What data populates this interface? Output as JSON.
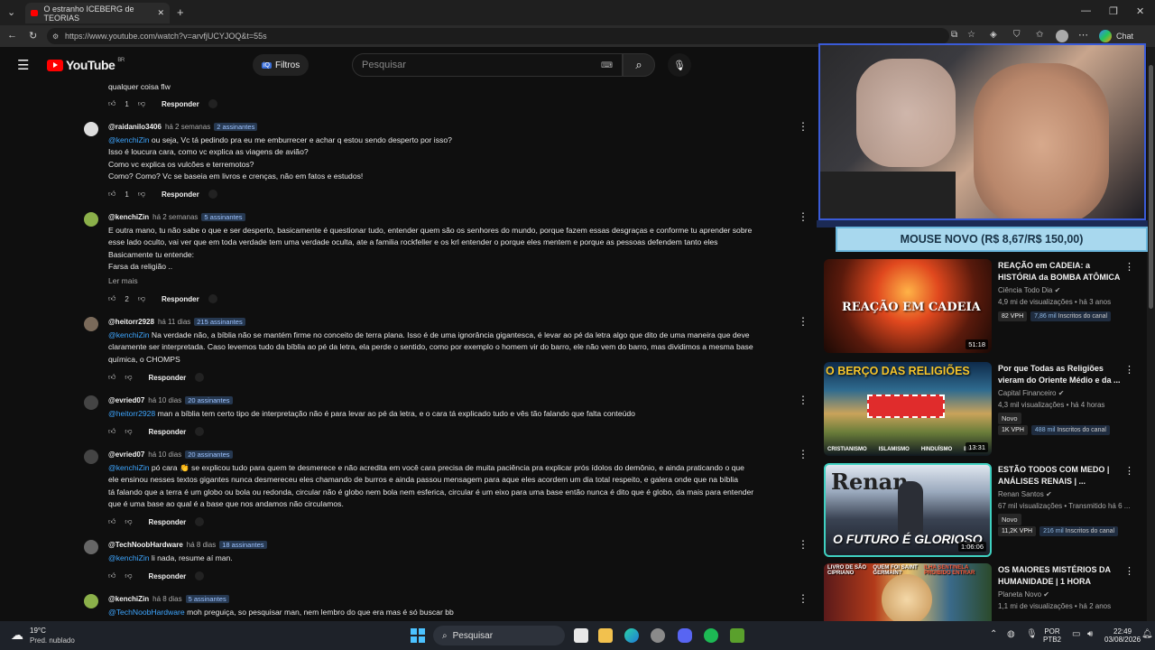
{
  "browser": {
    "tab_title": "O estranho ICEBERG de TEORIAS",
    "url": "https://www.youtube.com/watch?v=arvfjUCYJOQ&t=55s",
    "copilot_label": "Chat"
  },
  "header": {
    "logo_text": "YouTube",
    "logo_region": "BR",
    "filters_label": "Filtros",
    "search_placeholder": "Pesquisar"
  },
  "comments": [
    {
      "text": "qualquer coisa flw",
      "likes": "1",
      "reply": "Responder"
    },
    {
      "handle": "@raidanilo3406",
      "time": "há 2 semanas",
      "badge": "2 assinantes",
      "lines": [
        {
          "mention": "@kenchiZin",
          "text": " ou seja, Vc tá pedindo pra eu me emburrecer e achar q estou sendo desperto por isso?"
        },
        {
          "text": "Isso é loucura cara, como vc explica as viagens de avião?"
        },
        {
          "text": "Como vc explica os vulcões e terremotos?"
        },
        {
          "text": "Como? Como? Vc se baseia em livros e crenças, não em fatos e estudos!"
        }
      ],
      "likes": "1",
      "reply": "Responder"
    },
    {
      "handle": "@kenchiZin",
      "time": "há 2 semanas",
      "badge": "5 assinantes",
      "lines": [
        {
          "text": "E outra mano, tu não sabe o que e ser desperto, basicamente é questionar tudo, entender quem são os senhores do mundo, porque fazem essas desgraças e conforme tu aprender sobre"
        },
        {
          "text": "esse lado oculto, vai ver que em toda verdade tem uma verdade oculta, ate a familia rockfeller e os krl entender o porque eles mentem e porque as pessoas defendem tanto eles"
        },
        {
          "text": "Basicamente tu entende:"
        },
        {
          "text": "Farsa da religião .."
        }
      ],
      "read_more": "Ler mais",
      "likes": "2",
      "reply": "Responder"
    },
    {
      "handle": "@heitorr2928",
      "time": "há 11 dias",
      "badge": "215 assinantes",
      "lines": [
        {
          "mention": "@kenchiZin",
          "text": " Na verdade não, a bíblia não se mantém firme no conceito de terra plana. Isso é de uma ignorância gigantesca, é levar ao pé da letra algo que dito de uma maneira que deve"
        },
        {
          "text": "claramente ser interpretada. Caso levemos tudo da bíblia ao pé da letra, ela perde o sentido, como por exemplo o homem vir do barro, ele não vem do barro, mas dividimos a mesma base"
        },
        {
          "text": "química, o CHOMPS"
        }
      ],
      "reply": "Responder"
    },
    {
      "handle": "@evried07",
      "time": "há 10 dias",
      "badge": "20 assinantes",
      "lines": [
        {
          "mention": "@heitorr2928",
          "text": " man a bíblia tem certo tipo de interpretação não é para levar ao pé da letra, e o cara tá explicado tudo e vês tão falando que falta conteúdo"
        }
      ],
      "reply": "Responder"
    },
    {
      "handle": "@evried07",
      "time": "há 10 dias",
      "badge": "20 assinantes",
      "lines": [
        {
          "mention": "@kenchiZin",
          "text": " pó cara 👏 se explicou tudo para quem te desmerece e não acredita em você cara precisa de muita paciência pra explicar prós ídolos do demônio, e ainda praticando o que"
        },
        {
          "text": "ele ensinou nesses textos gigantes nunca desmereceu eles chamando de burros e ainda passou mensagem para aque eles acordem um dia total respeito, e galera onde que na bíblia"
        },
        {
          "text": "tá falando que a terra é um globo ou bola ou redonda, circular não é globo nem bola nem esferica, circular é um eixo para uma base então nunca é dito que é globo, da mais para entender"
        },
        {
          "text": "que é uma base ao qual é a base que nos andamos não circulamos."
        }
      ],
      "reply": "Responder"
    },
    {
      "handle": "@TechNoobHardware",
      "time": "há 8 dias",
      "badge": "18 assinantes",
      "lines": [
        {
          "mention": "@kenchiZin",
          "text": " li nada, resume aí man."
        }
      ],
      "reply": "Responder"
    },
    {
      "handle": "@kenchiZin",
      "time": "há 8 dias",
      "badge": "5 assinantes",
      "lines": [
        {
          "mention": "@TechNoobHardware",
          "text": "  moh preguiça, so pesquisar man, nem lembro do que era mas é só buscar bb"
        }
      ]
    }
  ],
  "promo_banner": "MOUSE NOVO (R$ 8,67/R$ 150,00)",
  "recommendations": [
    {
      "title": "REAÇÃO em CADEIA: a HISTÓRIA da BOMBA ATÔMICA",
      "channel": "Ciência Todo Dia",
      "meta": "4,9 mi de visualizações • há 3 anos",
      "vph": "82 VPH",
      "subs_num": "7,86 mil",
      "subs_label": "Inscritos do canal",
      "duration": "51:18",
      "thumb_text": "REAÇÃO EM CADEIA"
    },
    {
      "title": "Por que Todas as Religiões vieram do Oriente Médio e da ...",
      "channel": "Capital Financeiro",
      "meta": "4,3 mil visualizações • há 4 horas",
      "novo": "Novo",
      "vph": "1K VPH",
      "subs_num": "488 mil",
      "subs_label": "Inscritos do canal",
      "duration": "13:31",
      "thumb_text": "O BERÇO DAS RELIGIÕES",
      "thumb_labels": [
        "CRISTIANISMO",
        "ISLAMISMO",
        "HINDUÍSMO",
        "BU"
      ]
    },
    {
      "title": "ESTÃO TODOS COM MEDO | ANÁLISES RENAIS | ...",
      "channel": "Renan Santos",
      "meta": "67 mil visualizações • Transmitido há 6 ...",
      "novo": "Novo",
      "vph": "11,2K VPH",
      "subs_num": "216 mil",
      "subs_label": "Inscritos do canal",
      "duration": "1:06:06",
      "thumb_text": "O FUTURO É GLORIOSO",
      "thumb_top": "Renan"
    },
    {
      "title": "OS MAIORES MISTÉRIOS DA HUMANIDADE | 1 HORA",
      "channel": "Planeta Novo",
      "meta": "1,1 mi de visualizações • há 2 anos",
      "thumb_labels": [
        "LIVRO DE SÃO CIPRIANO",
        "QUEM FOI SAINT GERMAIN?",
        "ILHA SENTINELA PROIBIDO ENTRAR"
      ]
    }
  ],
  "taskbar": {
    "weather_temp": "19°C",
    "weather_desc": "Pred. nublado",
    "search_label": "Pesquisar",
    "lang": "POR",
    "lang_sub": "PTB2",
    "time": "22:49",
    "date": "03/08/2026"
  },
  "colors": {
    "accent_blue": "#3ea6ff",
    "youtube_red": "#ff0000",
    "promo_bg": "#a8d8ee"
  }
}
